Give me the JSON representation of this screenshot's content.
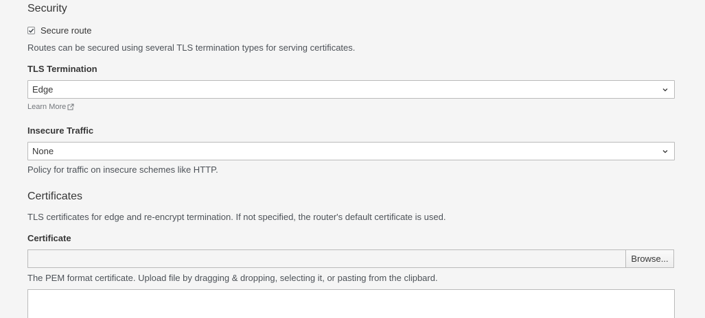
{
  "security": {
    "title": "Security",
    "secure_route_label": "Secure route",
    "secure_route_checked": true,
    "help": "Routes can be secured using several TLS termination types for serving certificates."
  },
  "tls_termination": {
    "label": "TLS Termination",
    "value": "Edge",
    "learn_more": "Learn More"
  },
  "insecure_traffic": {
    "label": "Insecure Traffic",
    "value": "None",
    "help": "Policy for traffic on insecure schemes like HTTP."
  },
  "certificates": {
    "title": "Certificates",
    "help": "TLS certificates for edge and re-encrypt termination. If not specified, the router's default certificate is used.",
    "certificate_label": "Certificate",
    "browse_label": "Browse...",
    "certificate_help": "The PEM format certificate. Upload file by dragging & dropping, selecting it, or pasting from the clipbard.",
    "certificate_value": ""
  }
}
